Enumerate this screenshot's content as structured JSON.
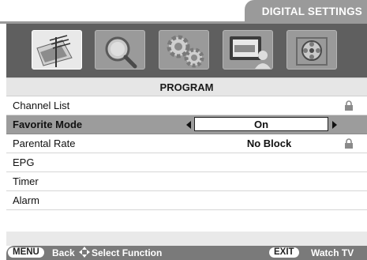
{
  "header": {
    "title": "DIGITAL SETTINGS"
  },
  "icons": [
    {
      "name": "antenna-picture-icon",
      "active": true
    },
    {
      "name": "magnifier-icon",
      "active": false
    },
    {
      "name": "gears-icon",
      "active": false
    },
    {
      "name": "tv-person-icon",
      "active": false
    },
    {
      "name": "film-reel-icon",
      "active": false
    }
  ],
  "program": {
    "title": "PROGRAM"
  },
  "menu": {
    "items": [
      {
        "label": "Channel List",
        "value": "",
        "locked": true,
        "selected": false
      },
      {
        "label": "Favorite Mode",
        "value": "On",
        "locked": false,
        "selected": true
      },
      {
        "label": "Parental Rate",
        "value": "No Block",
        "locked": true,
        "selected": false
      },
      {
        "label": "EPG",
        "value": "",
        "locked": false,
        "selected": false
      },
      {
        "label": "Timer",
        "value": "",
        "locked": false,
        "selected": false
      },
      {
        "label": "Alarm",
        "value": "",
        "locked": false,
        "selected": false
      }
    ]
  },
  "footer": {
    "menu_key": "MENU",
    "back_label": "Back",
    "select_label": "Select Function",
    "exit_key": "EXIT",
    "watch_label": "Watch TV"
  },
  "colors": {
    "header_gray": "#9a9a9a",
    "icon_bar": "#5f5f5f",
    "selected_row": "#9c9c9c",
    "footer": "#7a7a7a"
  }
}
